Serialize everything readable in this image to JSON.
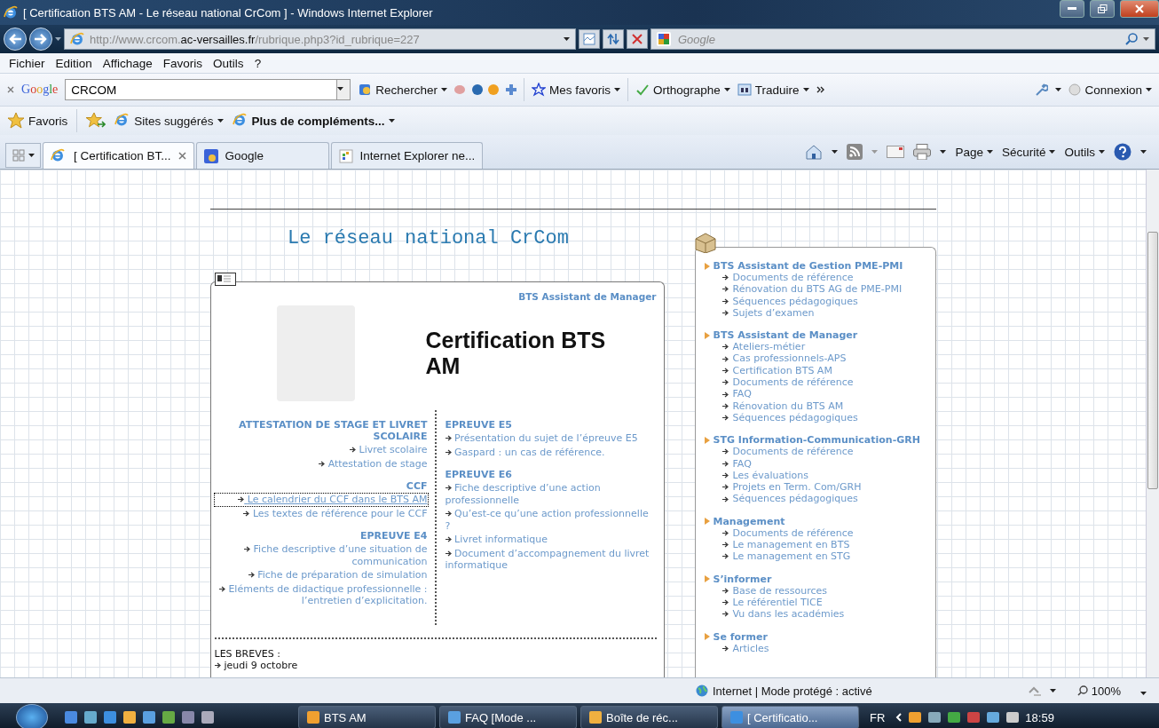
{
  "window": {
    "title": "[ Certification BTS AM - Le réseau national CrCom ] - Windows Internet Explorer"
  },
  "address_bar": {
    "url_scheme": "http://www.crcom.",
    "url_domain": "ac-versailles.fr",
    "url_path": "/rubrique.php3?id_rubrique=227"
  },
  "search_box": {
    "placeholder": "Google"
  },
  "menu": [
    "Fichier",
    "Edition",
    "Affichage",
    "Favoris",
    "Outils",
    "?"
  ],
  "google_toolbar": {
    "logo": "Google",
    "query": "CRCOM",
    "buttons": [
      "Rechercher",
      "Mes favoris",
      "Orthographe",
      "Traduire"
    ],
    "account": "Connexion"
  },
  "favorites_bar": {
    "label": "Favoris",
    "items": [
      {
        "label": "Sites suggérés",
        "bold": false
      },
      {
        "label": "Plus de compléments...",
        "bold": true
      }
    ]
  },
  "tabs": [
    {
      "label": "[ Certification BT...",
      "selected": true
    },
    {
      "label": "Google",
      "selected": false
    },
    {
      "label": "Internet Explorer ne...",
      "selected": false
    }
  ],
  "command_bar": [
    "Page",
    "Sécurité",
    "Outils"
  ],
  "page": {
    "site_title": "Le réseau national CrCom",
    "rubric": "BTS Assistant de Manager",
    "heading": "Certification BTS AM",
    "left_sections": [
      {
        "heading": "ATTESTATION DE STAGE ET LIVRET SCOLAIRE",
        "links": [
          {
            "text": "Livret scolaire",
            "focused": false
          },
          {
            "text": "Attestation de stage",
            "focused": false
          }
        ]
      },
      {
        "heading": "CCF",
        "links": [
          {
            "text": "Le calendrier du CCF dans le BTS AM",
            "focused": true
          },
          {
            "text": "Les textes de référence pour le CCF",
            "focused": false
          }
        ]
      },
      {
        "heading": "EPREUVE E4",
        "links": [
          {
            "text": "Fiche descriptive d’une situation de communication",
            "focused": false
          },
          {
            "text": "Fiche de préparation de simulation",
            "focused": false
          },
          {
            "text": "Eléments de didactique professionnelle : l’entretien d’explicitation.",
            "focused": false
          }
        ]
      }
    ],
    "right_sections": [
      {
        "heading": "EPREUVE E5",
        "links": [
          {
            "text": "Présentation du sujet de l’épreuve E5",
            "focused": false
          },
          {
            "text": "Gaspard : un cas de référence.",
            "focused": false
          }
        ]
      },
      {
        "heading": "EPREUVE E6",
        "links": [
          {
            "text": "Fiche descriptive d’une action professionnelle",
            "focused": false
          },
          {
            "text": "Qu’est-ce qu’une action professionnelle ?",
            "focused": false
          },
          {
            "text": "Livret informatique",
            "focused": false
          },
          {
            "text": "Document d’accompagnement du livret informatique",
            "focused": false
          }
        ]
      }
    ],
    "breves": {
      "title": "LES BREVES :",
      "items": [
        "jeudi 9 octobre"
      ]
    }
  },
  "sidebar": {
    "sections": [
      {
        "heading": "BTS Assistant de Gestion PME-PMI",
        "links": [
          "Documents de référence",
          "Rénovation du BTS AG de PME-PMI",
          "Séquences pédagogiques",
          "Sujets d’examen"
        ]
      },
      {
        "heading": "BTS Assistant de Manager",
        "links": [
          "Ateliers-métier",
          "Cas professionnels-APS",
          "Certification BTS AM",
          "Documents de référence",
          "FAQ",
          "Rénovation du BTS AM",
          "Séquences pédagogiques"
        ]
      },
      {
        "heading": "STG Information-Communication-GRH",
        "links": [
          "Documents de référence",
          "FAQ",
          "Les évaluations",
          "Projets en Term. Com/GRH",
          "Séquences pédagogiques"
        ]
      },
      {
        "heading": "Management",
        "links": [
          "Documents de référence",
          "Le management en BTS",
          "Le management en STG"
        ]
      },
      {
        "heading": "S’informer",
        "links": [
          "Base de ressources",
          "Le référentiel TICE",
          "Vu dans les académies"
        ]
      },
      {
        "heading": "Se former",
        "links": [
          "Articles"
        ]
      }
    ]
  },
  "status_bar": {
    "zone": "Internet | Mode protégé : activé",
    "zoom": "100%"
  },
  "taskbar": {
    "tasks": [
      {
        "label": "BTS AM",
        "selected": false
      },
      {
        "label": "FAQ [Mode ...",
        "selected": false
      },
      {
        "label": "Boîte de réc...",
        "selected": false
      },
      {
        "label": "[ Certificatio...",
        "selected": true
      }
    ],
    "language": "FR",
    "clock": "18:59"
  }
}
